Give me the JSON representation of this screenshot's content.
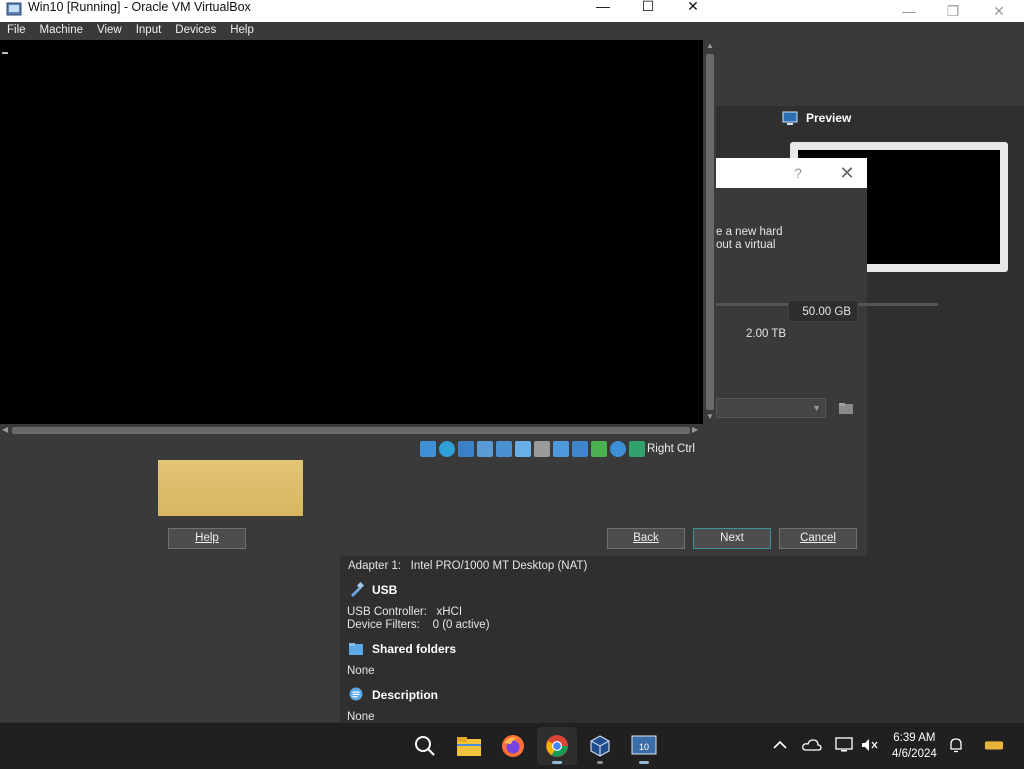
{
  "vm_window": {
    "title": "Win10 [Running] - Oracle VM VirtualBox",
    "controls": {
      "minimize": "—",
      "maximize": "☐",
      "close": "✕"
    },
    "menu": [
      "File",
      "Machine",
      "View",
      "Input",
      "Devices",
      "Help"
    ],
    "host_key": "Right Ctrl"
  },
  "manager": {
    "preview_title": "Preview",
    "window_controls": {
      "minimize": "—",
      "maximize": "❐",
      "close": "✕"
    },
    "network": {
      "adapter_label": "Adapter 1:",
      "adapter_value": "Intel PRO/1000 MT Desktop (NAT)"
    },
    "usb": {
      "title": "USB",
      "controller_label": "USB Controller:",
      "controller_value": "xHCI",
      "filters_label": "Device Filters:",
      "filters_value": "0 (0 active)"
    },
    "shared_folders": {
      "title": "Shared folders",
      "value": "None"
    },
    "description": {
      "title": "Description",
      "value": "None"
    }
  },
  "wizard": {
    "help_glyph": "?",
    "close_glyph": "✕",
    "desc_line1": "e a new hard",
    "desc_line2": "out a virtual",
    "size_value": "50.00 GB",
    "max_label": "2.00 TB",
    "buttons": {
      "help": "Help",
      "back": "Back",
      "next": "Next",
      "cancel": "Cancel"
    }
  },
  "taskbar": {
    "time": "6:39 AM",
    "date": "4/6/2024",
    "apps": [
      "search-icon",
      "file-explorer-icon",
      "firefox-icon",
      "chrome-icon",
      "virtualbox-icon",
      "win10-vm-icon"
    ]
  },
  "colors": {
    "accent": "#3f8f9e",
    "dark_bg": "#3a3a3a",
    "taskbar": "#202020"
  }
}
